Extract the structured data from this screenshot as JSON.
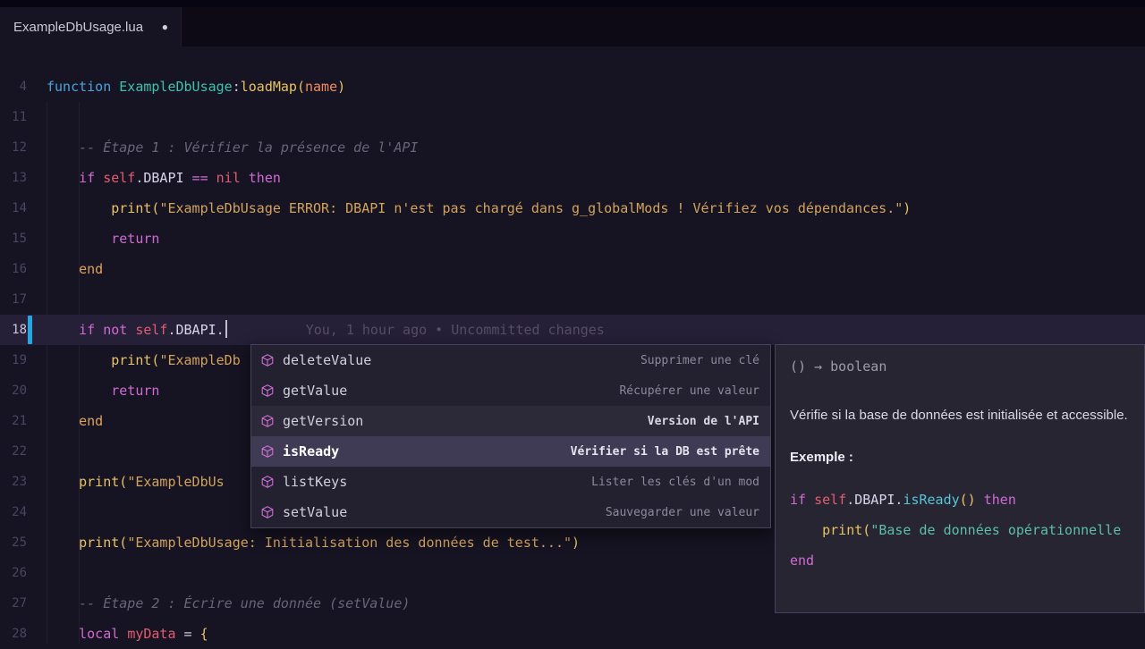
{
  "accent_colors": {
    "git_modified": "#27a7e0",
    "selection": "#403b55",
    "symbol_icon": "#cd6fd4"
  },
  "tab_bar": {
    "tabs": [
      {
        "title": "ExampleDbUsage.lua",
        "modified": "●"
      }
    ]
  },
  "editor": {
    "lines": [
      {
        "n": "4",
        "tokens": [
          [
            "kw",
            "function "
          ],
          [
            "type",
            "ExampleDbUsage"
          ],
          [
            "plain",
            ":"
          ],
          [
            "fn",
            "loadMap"
          ],
          [
            "punc",
            "("
          ],
          [
            "param",
            "name"
          ],
          [
            "punc",
            ")"
          ]
        ]
      },
      {
        "n": "11",
        "tokens": []
      },
      {
        "n": "12",
        "tokens": [
          [
            "com",
            "    -- Étape 1 : Vérifier la présence de l'API"
          ]
        ]
      },
      {
        "n": "13",
        "tokens": [
          [
            "ctrl",
            "    if "
          ],
          [
            "self",
            "self"
          ],
          [
            "plain",
            "."
          ],
          [
            "prop",
            "DBAPI"
          ],
          [
            "ctrl",
            " == "
          ],
          [
            "nil",
            "nil"
          ],
          [
            "ctrl",
            " then"
          ]
        ]
      },
      {
        "n": "14",
        "tokens": [
          [
            "fn",
            "        print"
          ],
          [
            "punc",
            "("
          ],
          [
            "str",
            "\"ExampleDbUsage ERROR: DBAPI n'est pas chargé dans g_globalMods ! Vérifiez vos dépendances.\""
          ],
          [
            "punc",
            ")"
          ]
        ]
      },
      {
        "n": "15",
        "tokens": [
          [
            "ctrl",
            "        return"
          ]
        ]
      },
      {
        "n": "16",
        "tokens": [
          [
            "end",
            "    end"
          ]
        ]
      },
      {
        "n": "17",
        "tokens": []
      },
      {
        "n": "18",
        "active": true,
        "git": true,
        "cursor": true,
        "blame": "You, 1 hour ago • Uncommitted changes",
        "tokens": [
          [
            "ctrl",
            "    if not "
          ],
          [
            "self",
            "self"
          ],
          [
            "plain",
            "."
          ],
          [
            "prop",
            "DBAPI"
          ],
          [
            "plain",
            "."
          ]
        ]
      },
      {
        "n": "19",
        "tokens": [
          [
            "fn",
            "        print"
          ],
          [
            "punc",
            "("
          ],
          [
            "str",
            "\"ExampleDb"
          ]
        ]
      },
      {
        "n": "20",
        "tokens": [
          [
            "ctrl",
            "        return"
          ]
        ]
      },
      {
        "n": "21",
        "tokens": [
          [
            "end",
            "    end"
          ]
        ]
      },
      {
        "n": "22",
        "tokens": []
      },
      {
        "n": "23",
        "tokens": [
          [
            "fn",
            "    print"
          ],
          [
            "punc",
            "("
          ],
          [
            "str",
            "\"ExampleDbUs"
          ]
        ]
      },
      {
        "n": "24",
        "tokens": []
      },
      {
        "n": "25",
        "tokens": [
          [
            "fn",
            "    print"
          ],
          [
            "punc",
            "("
          ],
          [
            "str",
            "\"ExampleDbUsage: Initialisation des données de test...\""
          ],
          [
            "punc",
            ")"
          ]
        ]
      },
      {
        "n": "26",
        "tokens": []
      },
      {
        "n": "27",
        "tokens": [
          [
            "com",
            "    -- Étape 2 : Écrire une donnée (setValue)"
          ]
        ]
      },
      {
        "n": "28",
        "tokens": [
          [
            "ctrl",
            "    local "
          ],
          [
            "self",
            "myData"
          ],
          [
            "plain",
            " = "
          ],
          [
            "punc",
            "{"
          ]
        ]
      }
    ]
  },
  "suggest": {
    "icon": "symbol-method-cube-icon",
    "items": [
      {
        "label": "deleteValue",
        "detail": "Supprimer une clé"
      },
      {
        "label": "getValue",
        "detail": "Récupérer une valeur"
      },
      {
        "label": "getVersion",
        "detail": "Version de l'API",
        "hover": true
      },
      {
        "label": "isReady",
        "detail": "Vérifier si la DB est prête",
        "selected": true
      },
      {
        "label": "listKeys",
        "detail": "Lister les clés d'un mod"
      },
      {
        "label": "setValue",
        "detail": "Sauvegarder une valeur"
      }
    ]
  },
  "doc": {
    "signature": "() → boolean",
    "description": "Vérifie si la base de données est initialisée et accessible.",
    "example_label": "Exemple :",
    "code": [
      [
        [
          "ctrl",
          "if "
        ],
        [
          "self",
          "self"
        ],
        [
          "plain",
          "."
        ],
        [
          "prop",
          "DBAPI"
        ],
        [
          "plain",
          "."
        ],
        [
          "cyanfn",
          "isReady"
        ],
        [
          "punc",
          "()"
        ],
        [
          "ctrl",
          " then"
        ]
      ],
      [
        [
          "fn",
          "    print"
        ],
        [
          "punc",
          "("
        ],
        [
          "strdoc",
          "\"Base de données opérationnelle"
        ]
      ],
      [
        [
          "ctrl",
          "end"
        ]
      ]
    ]
  }
}
